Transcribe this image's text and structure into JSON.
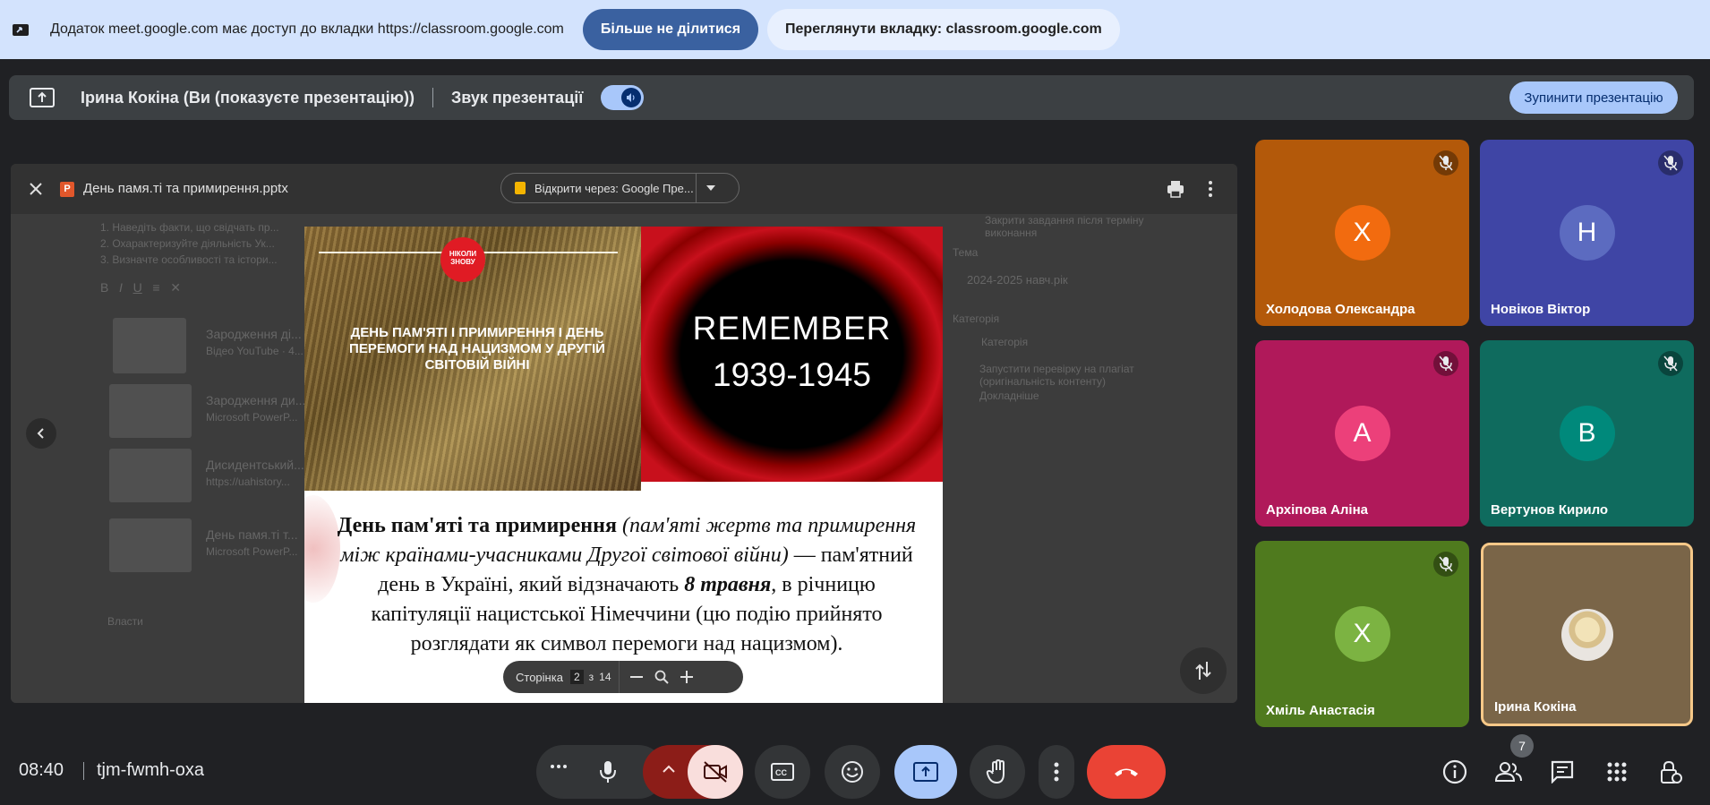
{
  "share_bar": {
    "text": "Додаток meet.google.com має доступ до вкладки https://classroom.google.com",
    "stop_sharing": "Більше не ділитися",
    "view_tab": "Переглянути вкладку: classroom.google.com"
  },
  "present_bar": {
    "presenter": "Ірина Кокіна (Ви (показуєте презентацію))",
    "audio_label": "Звук презентації",
    "stop_presenting": "Зупинити презентацію"
  },
  "presentation": {
    "file_name": "День памя.ті та примирення.pptx",
    "open_with": "Відкрити через: Google Пре...",
    "page_label": "Сторінка",
    "current_page": "2",
    "of": "з",
    "total_pages": "14"
  },
  "background_doc": {
    "lines": [
      "1. Наведіть факти, що свідчать пр...",
      "2. Охарактеризуйте діяльність Ук...",
      "3. Визначте особливості та істори..."
    ],
    "attachments": [
      {
        "title": "Зародження ді...",
        "sub": "Відео YouTube · 4..."
      },
      {
        "title": "Зародження ди...",
        "sub": "Microsoft PowerP..."
      },
      {
        "title": "Дисидентський...",
        "sub": "https://uahistory..."
      },
      {
        "title": "День памя.ті т...",
        "sub": "Microsoft PowerP..."
      }
    ],
    "footer": "Власти",
    "right": {
      "close_after": "Закрити завдання після терміну виконання",
      "topic_label": "Тема",
      "topic_value": "2024-2025 навч.рік",
      "category_label": "Категорія",
      "category_add": "Категорія",
      "plagiarism": "Запустити перевірку на плагіат (оригінальність контенту)",
      "more": "Докладніше"
    }
  },
  "slide": {
    "logo_text": "НІКОЛИ ЗНОВУ",
    "photo_title": "ДЕНЬ ПАМ'ЯТІ І ПРИМИРЕННЯ І ДЕНЬ ПЕРЕМОГИ НАД НАЦИЗМОМ У ДРУГІЙ СВІТОВІЙ ВІЙНІ",
    "remember": "REMEMBER",
    "years": "1939-1945",
    "body_bold": "День пам'яті та примирення",
    "body_italic": "(пам'яті жертв та примирення між країнами-учасниками Другої світової війни)",
    "body_mid": " — пам'ятний день в Україні, який відзначають ",
    "body_date": "8 травня",
    "body_end": ", в річницю капітуляції нацистської Німеччини (цю подію прийнято розглядати як символ перемоги над нацизмом)."
  },
  "participants": [
    {
      "name": "Холодова Олександра",
      "initial": "Х",
      "bg": "#b3590a",
      "avatar": "#f26b0f",
      "muted": true
    },
    {
      "name": "Новіков Віктор",
      "initial": "Н",
      "bg": "#3f45a5",
      "avatar": "#5c6bc0",
      "muted": true
    },
    {
      "name": "Архіпова Аліна",
      "initial": "А",
      "bg": "#b0195a",
      "avatar": "#ec407a",
      "muted": true
    },
    {
      "name": "Вертунов Кирило",
      "initial": "В",
      "bg": "#0f6b5e",
      "avatar": "#00897b",
      "muted": true
    },
    {
      "name": "Хміль Анастасія",
      "initial": "Х",
      "bg": "#4f7a1e",
      "avatar": "#7cb342",
      "muted": true
    },
    {
      "name": "Ірина Кокіна",
      "initial": "",
      "bg": "#7a6548",
      "avatar": "#d9d2c4",
      "muted": false
    }
  ],
  "bottom": {
    "time": "08:40",
    "meeting_code": "tjm-fwmh-oxa",
    "people_count": "7"
  },
  "colors": {
    "banner": "#d3e3fd",
    "accent": "#a8c7fa",
    "end_call": "#ea4335",
    "camera_off": "#f9dedc"
  }
}
